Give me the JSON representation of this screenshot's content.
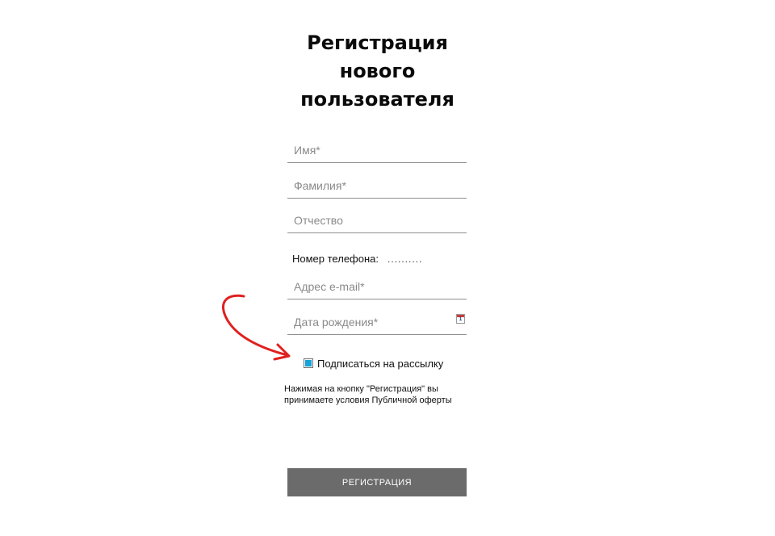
{
  "form": {
    "title_lines": [
      "Регистрация",
      "нового",
      "пользователя"
    ],
    "fields": {
      "first_name": {
        "placeholder": "Имя*",
        "value": ""
      },
      "last_name": {
        "placeholder": "Фамилия*",
        "value": ""
      },
      "middle_name": {
        "placeholder": "Отчество",
        "value": ""
      },
      "phone": {
        "label": "Номер телефона:",
        "placeholder": "..........",
        "value": ""
      },
      "email": {
        "placeholder": "Адрес e-mail*",
        "value": ""
      },
      "birth_date": {
        "placeholder": "Дата рождения*",
        "value": ""
      }
    },
    "calendar_icon_day": "1",
    "newsletter": {
      "label": "Подписаться на рассылку",
      "checked": true
    },
    "terms_lines": [
      "Нажимая на кнопку \"Регистрация\" вы",
      "принимаете условия Публичной оферты"
    ],
    "submit_label": "РЕГИСТРАЦИЯ"
  },
  "icons": {
    "calendar": "calendar-icon",
    "checkbox": "checkbox-checked-icon",
    "annotation": "red-arrow-icon"
  },
  "colors": {
    "submit_bg": "#6b6b6b",
    "checkbox_fill": "#16a3d8",
    "annotation_arrow": "#e02020",
    "field_underline": "#8e8e8e"
  }
}
